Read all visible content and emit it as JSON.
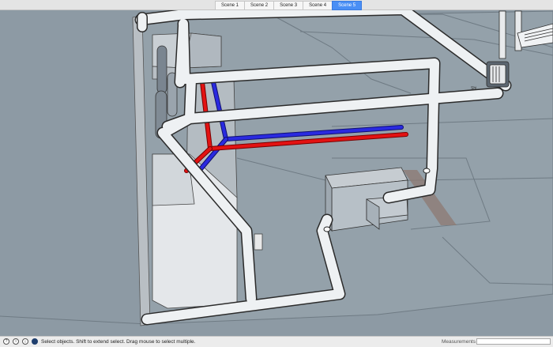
{
  "scene_tabs": [
    "Scene 1",
    "Scene 2",
    "Scene 3",
    "Scene 4",
    "Scene 5"
  ],
  "active_scene": "Scene 5",
  "status_bar": {
    "message": "Select objects. Shift to extend select. Drag mouse to select multiple.",
    "measurements_label": "Measurements",
    "measurements_value": "",
    "icons": [
      "help-icon",
      "info-icon",
      "user-icon"
    ]
  },
  "viewport": {
    "label": "Shi"
  },
  "colors": {
    "background": "#8d9aa4",
    "pipe": "#eef1f3",
    "hot_pipe": "#e01010",
    "cold_pipe": "#2222dd",
    "active_tab": "#4a8ff5"
  }
}
